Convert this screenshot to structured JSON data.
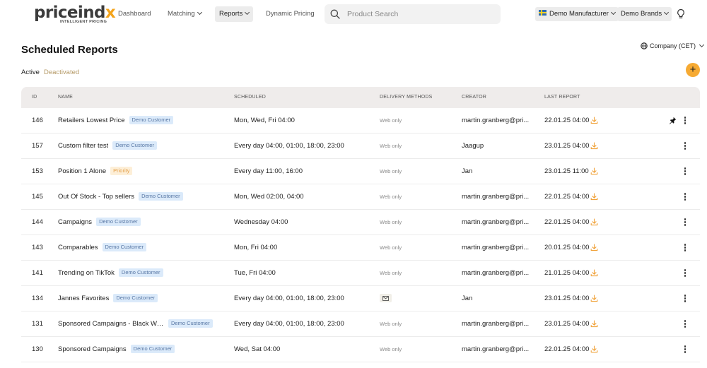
{
  "brand": {
    "name_main": "priceind",
    "name_accent": "x",
    "tagline": "INTELLIGENT PRICING"
  },
  "nav": {
    "dashboard": "Dashboard",
    "matching": "Matching",
    "reports": "Reports",
    "dynamic_pricing": "Dynamic Pricing"
  },
  "search": {
    "placeholder": "Product Search",
    "value": ""
  },
  "account": {
    "manufacturer": "Demo Manufacturer",
    "brands": "Demo Brands"
  },
  "page": {
    "title": "Scheduled Reports",
    "timezone": "Company (CET)",
    "tabs": {
      "active": "Active",
      "deactivated": "Deactivated"
    },
    "add_label": "+"
  },
  "table": {
    "headers": {
      "id": "ID",
      "name": "NAME",
      "scheduled": "SCHEDULED",
      "delivery": "DELIVERY METHODS",
      "creator": "CREATOR",
      "last_report": "LAST REPORT"
    },
    "rows": [
      {
        "id": "146",
        "name": "Retailers Lowest Price",
        "badge": "Demo Customer",
        "badge_color": "blue",
        "scheduled": "Mon, Wed, Fri 04:00",
        "delivery": "Web only",
        "creator": "martin.granberg@pri...",
        "last_report": "22.01.25 04:00",
        "pinned": true
      },
      {
        "id": "157",
        "name": "Custom filter test",
        "badge": "Demo Customer",
        "badge_color": "blue",
        "scheduled": "Every day 04:00, 01:00, 18:00, 23:00",
        "delivery": "Web only",
        "creator": "Jaagup",
        "last_report": "23.01.25 04:00",
        "pinned": false
      },
      {
        "id": "153",
        "name": "Position 1 Alone",
        "badge": "Priority",
        "badge_color": "orange",
        "scheduled": "Every day 11:00, 16:00",
        "delivery": "Web only",
        "creator": "Jan",
        "last_report": "23.01.25 11:00",
        "pinned": false
      },
      {
        "id": "145",
        "name": "Out Of Stock - Top sellers",
        "badge": "Demo Customer",
        "badge_color": "blue",
        "scheduled": "Mon, Wed 02:00, 04:00",
        "delivery": "Web only",
        "creator": "martin.granberg@pri...",
        "last_report": "22.01.25 04:00",
        "pinned": false
      },
      {
        "id": "144",
        "name": "Campaigns",
        "badge": "Demo Customer",
        "badge_color": "blue",
        "scheduled": "Wednesday 04:00",
        "delivery": "Web only",
        "creator": "martin.granberg@pri...",
        "last_report": "22.01.25 04:00",
        "pinned": false
      },
      {
        "id": "143",
        "name": "Comparables",
        "badge": "Demo Customer",
        "badge_color": "blue",
        "scheduled": "Mon, Fri 04:00",
        "delivery": "Web only",
        "creator": "martin.granberg@pri...",
        "last_report": "20.01.25 04:00",
        "pinned": false
      },
      {
        "id": "141",
        "name": "Trending on TikTok",
        "badge": "Demo Customer",
        "badge_color": "blue",
        "scheduled": "Tue, Fri 04:00",
        "delivery": "Web only",
        "creator": "martin.granberg@pri...",
        "last_report": "21.01.25 04:00",
        "pinned": false
      },
      {
        "id": "134",
        "name": "Jannes Favorites",
        "badge": "Demo Customer",
        "badge_color": "blue",
        "scheduled": "Every day 04:00, 01:00, 18:00, 23:00",
        "delivery": "",
        "delivery_icon": "mail-icon",
        "creator": "Jan",
        "last_report": "23.01.25 04:00",
        "pinned": false
      },
      {
        "id": "131",
        "name": "Sponsored Campaigns - Black Week...",
        "badge": "Demo Customer",
        "badge_color": "blue",
        "scheduled": "Every day 04:00, 01:00, 18:00, 23:00",
        "delivery": "Web only",
        "creator": "martin.granberg@pri...",
        "last_report": "23.01.25 04:00",
        "pinned": false
      },
      {
        "id": "130",
        "name": "Sponsored Campaigns",
        "badge": "Demo Customer",
        "badge_color": "blue",
        "scheduled": "Wed, Sat 04:00",
        "delivery": "Web only",
        "creator": "martin.granberg@pri...",
        "last_report": "22.01.25 04:00",
        "pinned": false
      }
    ]
  },
  "colors": {
    "accent": "#f6aa33",
    "download": "#f0a23a",
    "badge_blue_bg": "#dbeafa",
    "badge_orange_bg": "#fdefd8"
  },
  "icons": {
    "search": "search-icon",
    "bulb": "lightbulb-icon",
    "globe": "globe-icon",
    "download": "download-icon",
    "pin": "pin-icon",
    "more": "more-vertical-icon"
  }
}
